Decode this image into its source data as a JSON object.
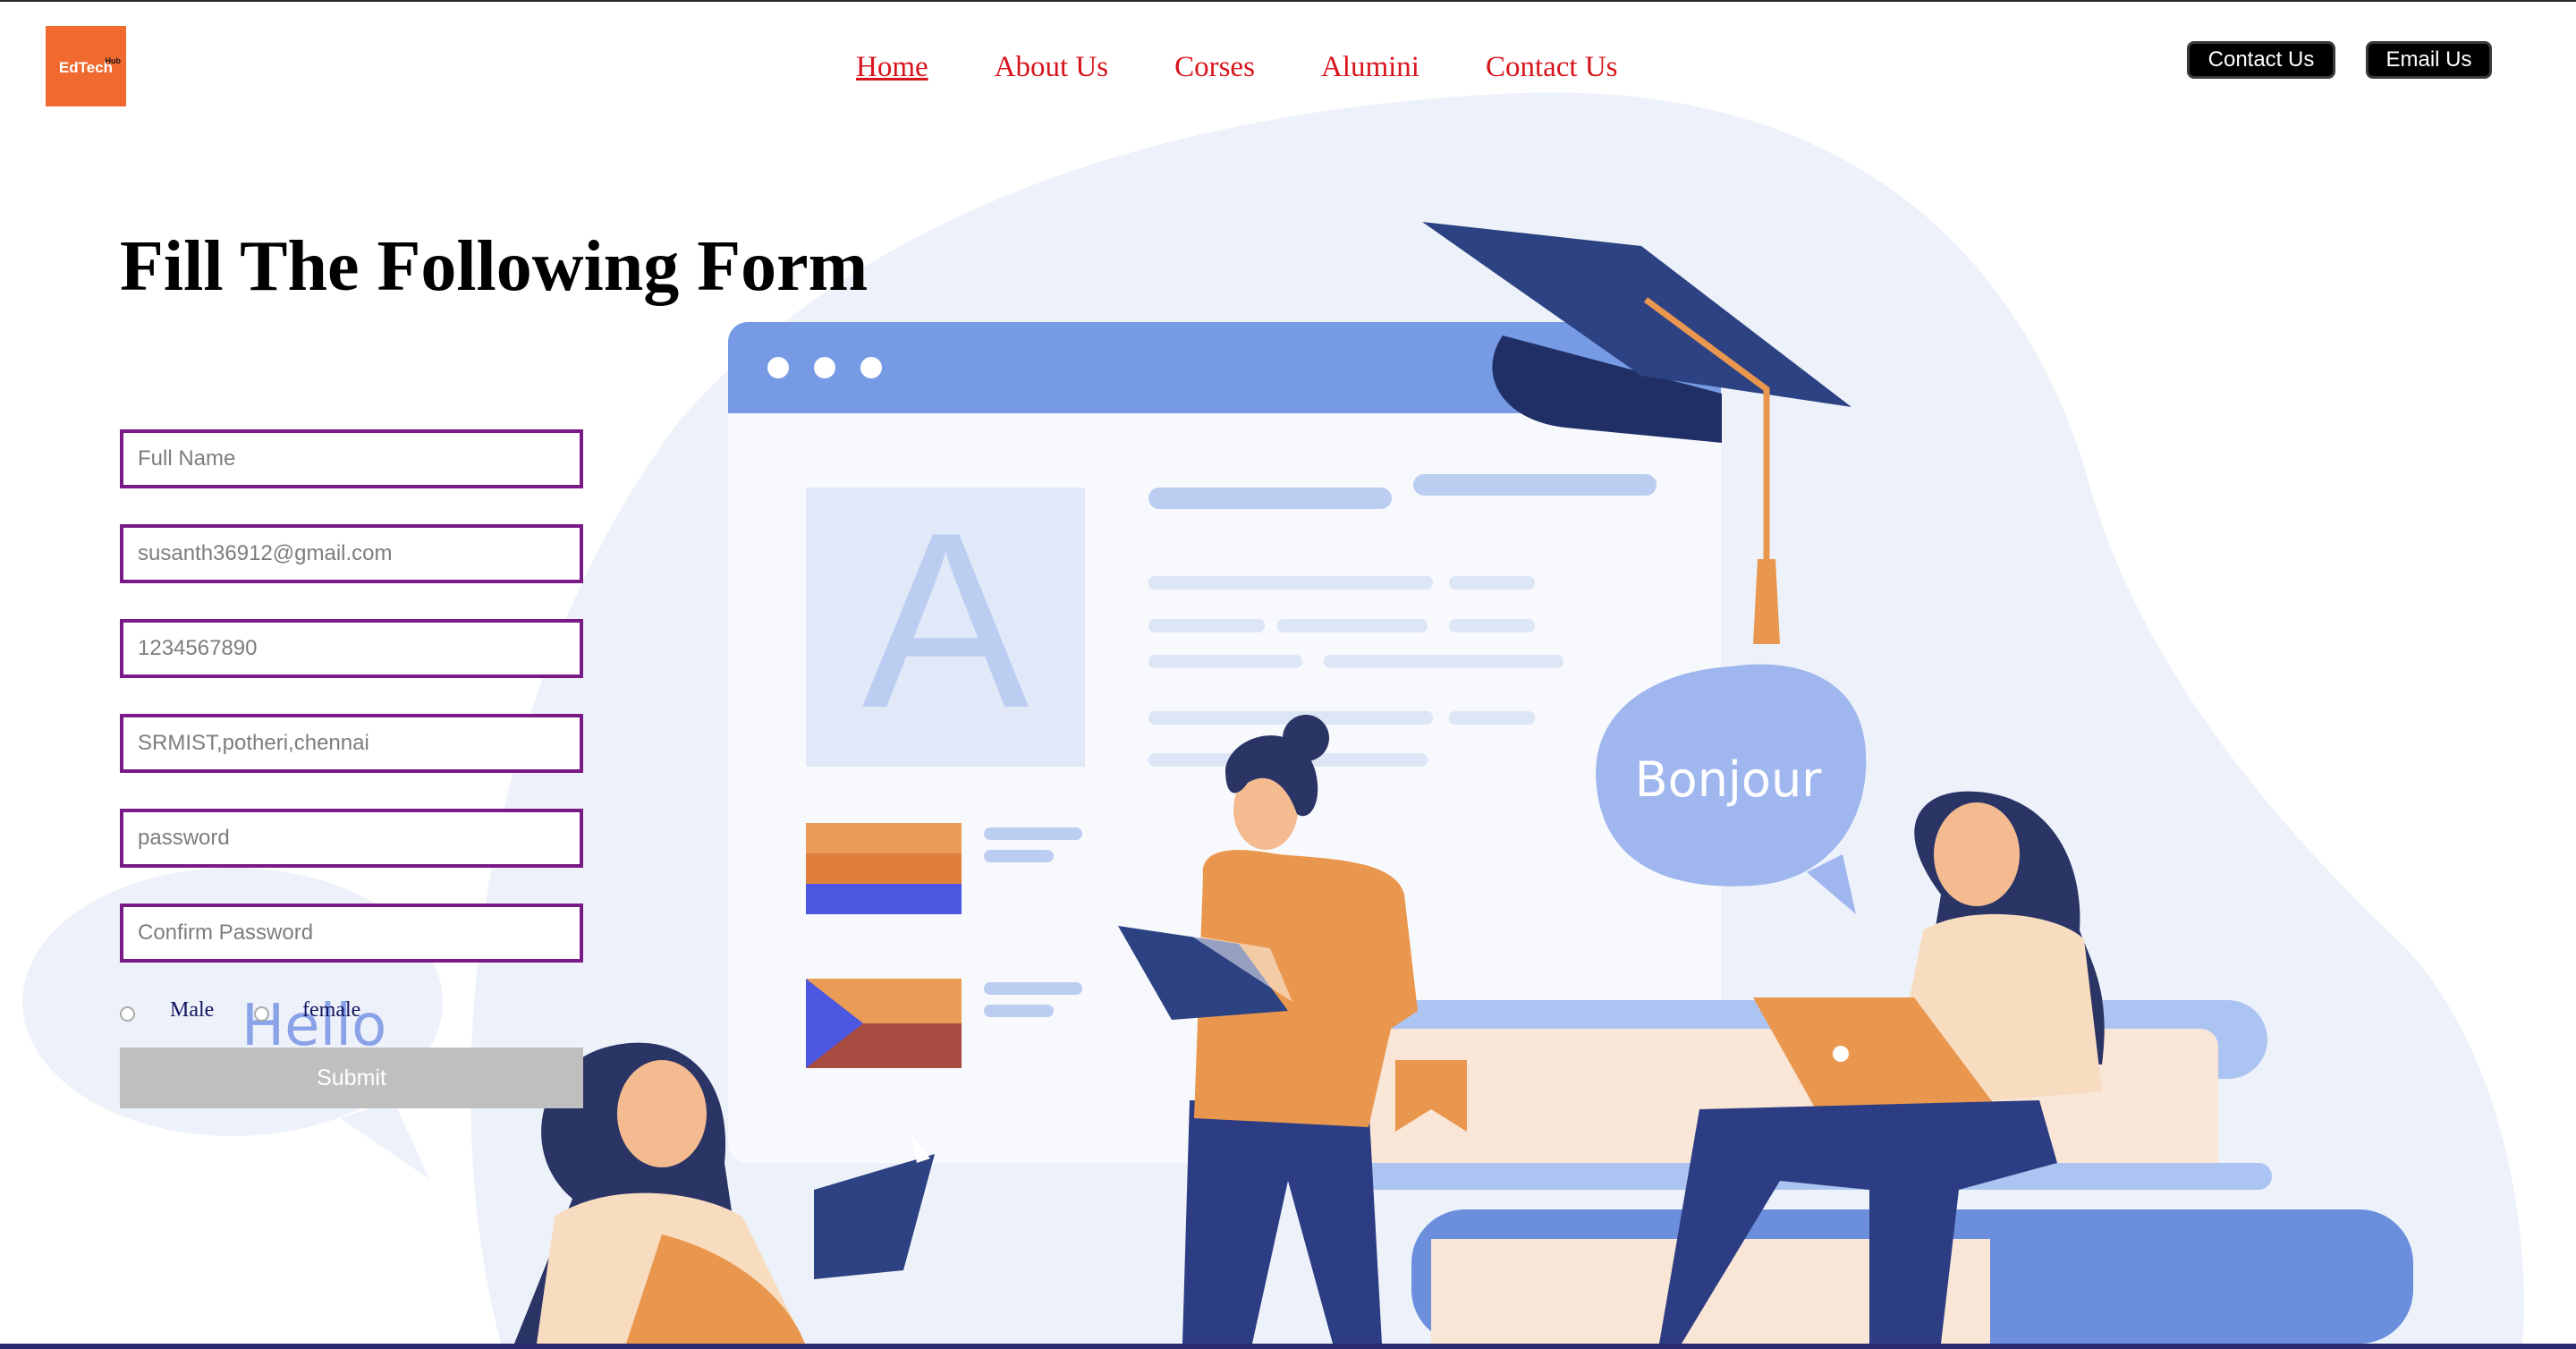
{
  "header": {
    "logo_text": "EdTech",
    "logo_superscript": "Hub",
    "nav": [
      "Home",
      "About Us",
      "Corses",
      "Alumini",
      "Contact Us"
    ],
    "active_nav": "Home",
    "contact_button": "Contact Us",
    "email_button": "Email Us"
  },
  "illustration": {
    "speech_bubble_text": "Bonjour",
    "hello_text": "Hello",
    "letter_card": "A"
  },
  "form": {
    "title": "Fill The Following Form",
    "fields": [
      {
        "placeholder": "Full Name",
        "value": ""
      },
      {
        "placeholder": "susanth36912@gmail.com",
        "value": ""
      },
      {
        "placeholder": "1234567890",
        "value": ""
      },
      {
        "placeholder": "SRMIST,potheri,chennai",
        "value": ""
      },
      {
        "placeholder": "password",
        "value": ""
      },
      {
        "placeholder": "Confirm Password",
        "value": ""
      }
    ],
    "gender_options": [
      "Male",
      "female"
    ],
    "submit_label": "Submit"
  },
  "colors": {
    "logo_bg": "#f0692f",
    "nav_link": "#d7141b",
    "field_border": "#7a1a86",
    "submit_bg": "#bfbfbf",
    "illustration_blue": "#769be4",
    "illustration_navy": "#2f3f7e",
    "illustration_orange": "#e9974e"
  }
}
